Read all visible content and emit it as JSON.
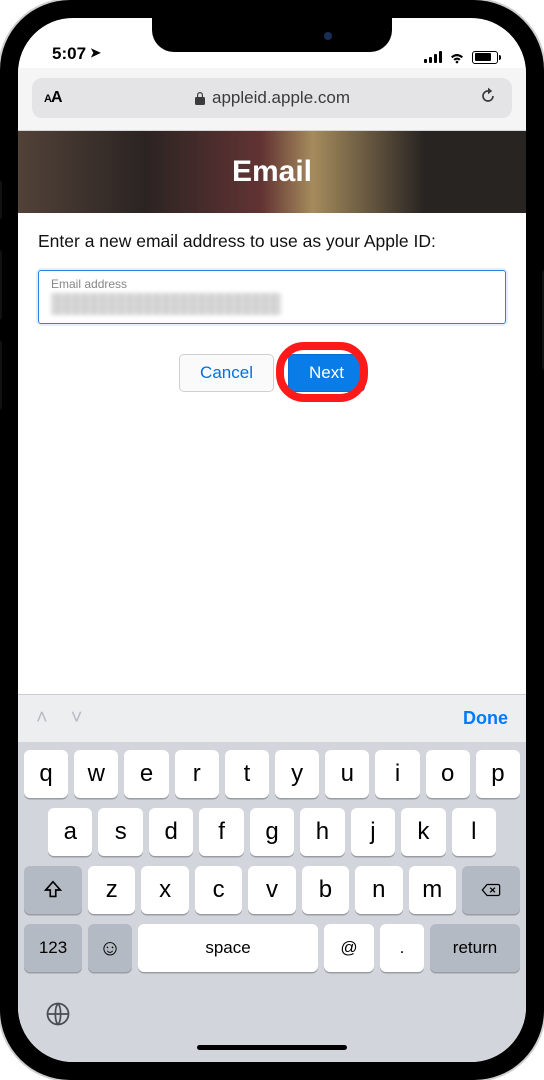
{
  "status": {
    "time": "5:07"
  },
  "safari": {
    "reader": "AA",
    "domain": "appleid.apple.com"
  },
  "header": {
    "title": "Email"
  },
  "form": {
    "instruction": "Enter a new email address to use as your Apple ID:",
    "email_label": "Email address",
    "cancel": "Cancel",
    "next": "Next"
  },
  "keyboard": {
    "done": "Done",
    "row1": [
      "q",
      "w",
      "e",
      "r",
      "t",
      "y",
      "u",
      "i",
      "o",
      "p"
    ],
    "row2": [
      "a",
      "s",
      "d",
      "f",
      "g",
      "h",
      "j",
      "k",
      "l"
    ],
    "row3": [
      "z",
      "x",
      "c",
      "v",
      "b",
      "n",
      "m"
    ],
    "numKey": "123",
    "space": "space",
    "at": "@",
    "dot": ".",
    "return": "return"
  }
}
